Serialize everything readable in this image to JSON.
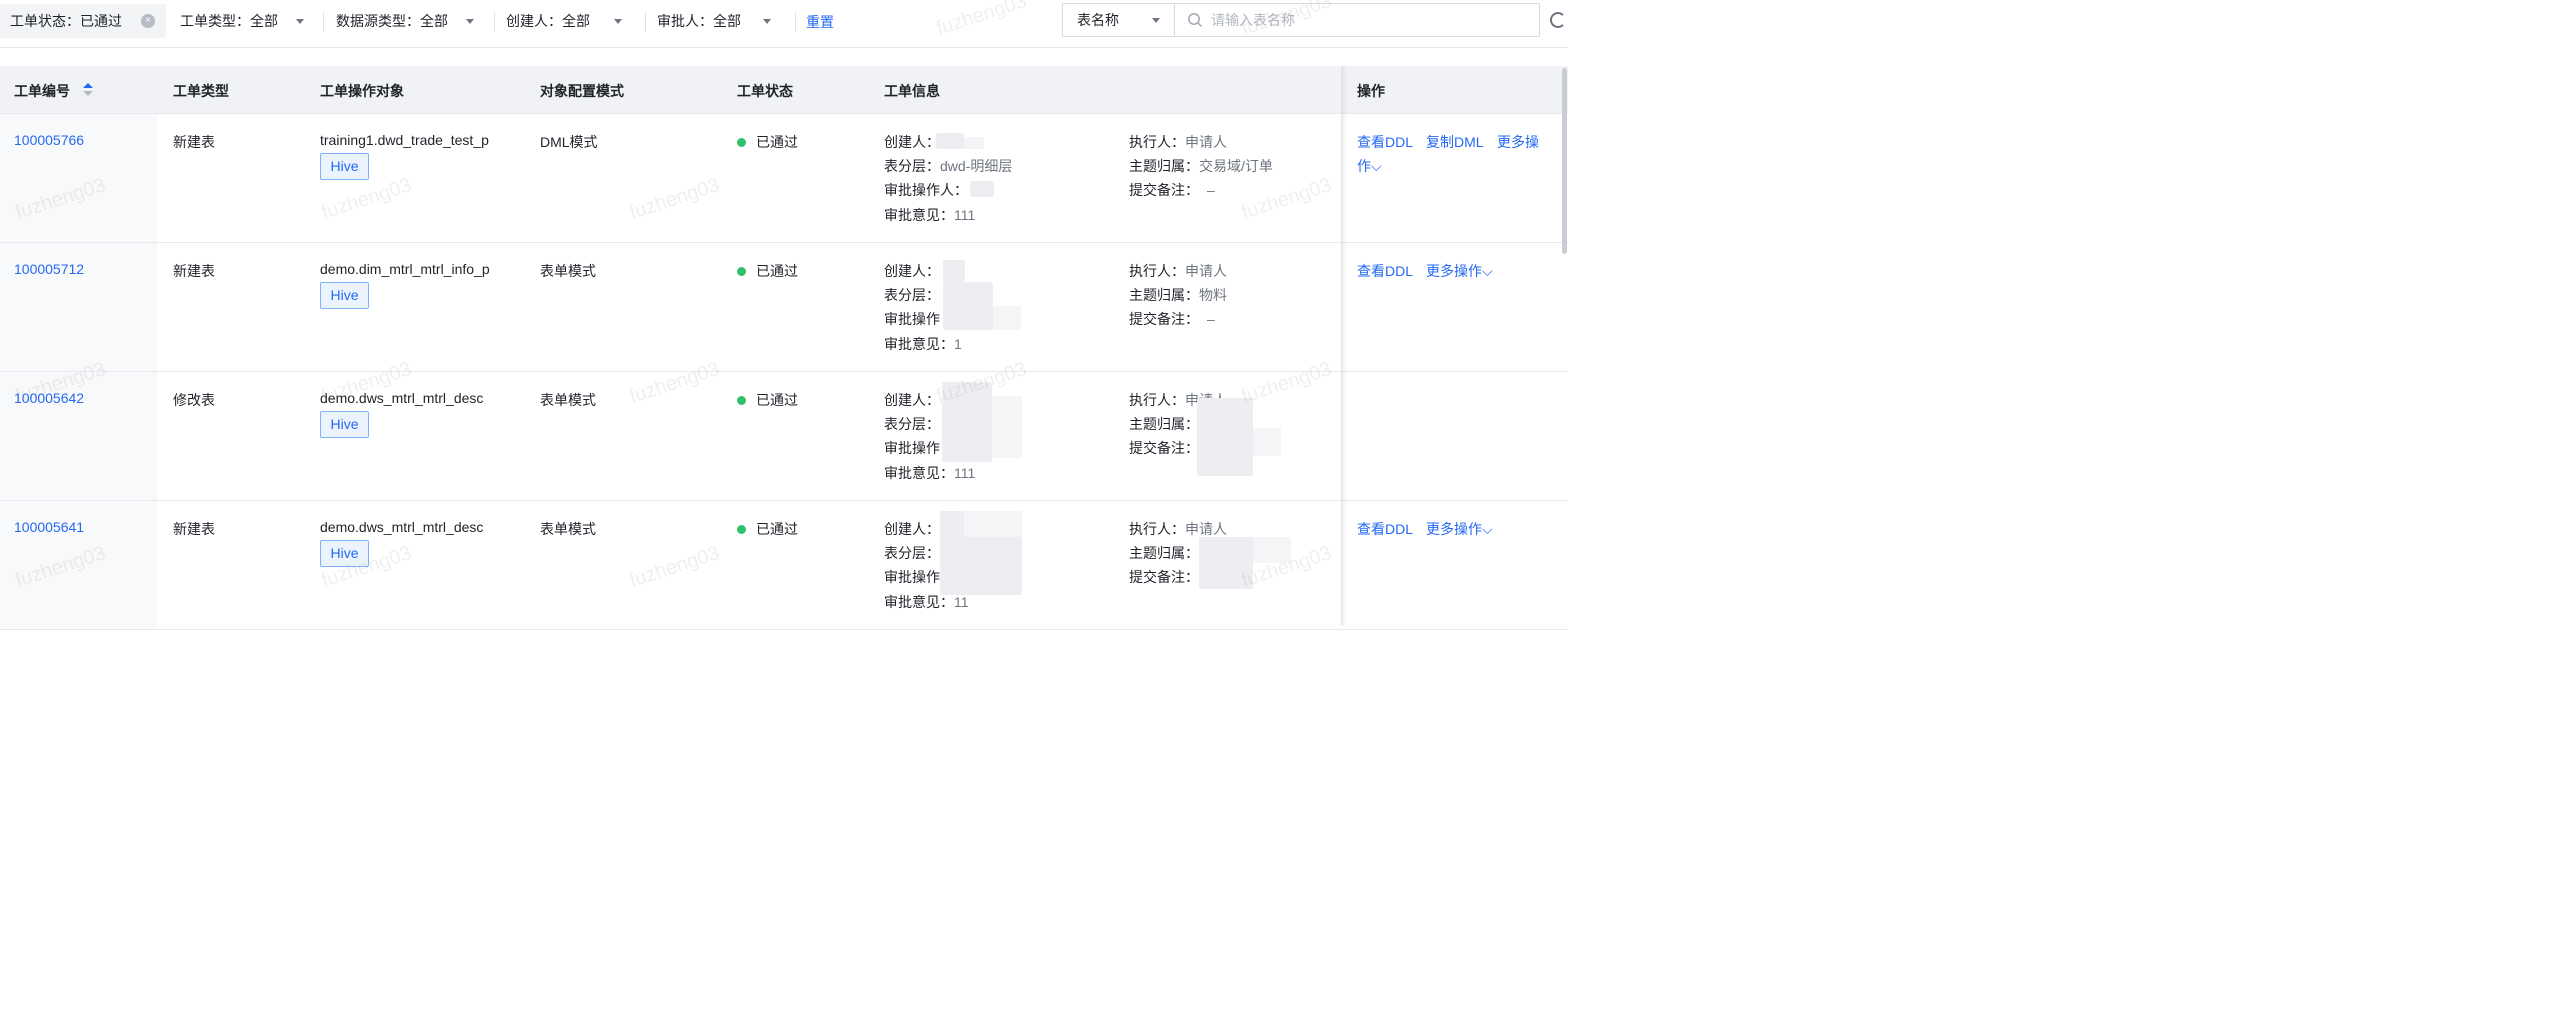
{
  "filters": {
    "status": {
      "label": "工单状态：",
      "value": "已通过"
    },
    "type": {
      "label": "工单类型：",
      "value": "全部"
    },
    "datasource": {
      "label": "数据源类型：",
      "value": "全部"
    },
    "creator": {
      "label": "创建人：",
      "value": "全部"
    },
    "approver": {
      "label": "审批人：",
      "value": "全部"
    },
    "reset": "重置"
  },
  "search": {
    "field_option": "表名称",
    "placeholder": "请输入表名称"
  },
  "table": {
    "headers": {
      "id": "工单编号",
      "type": "工单类型",
      "target": "工单操作对象",
      "mode": "对象配置模式",
      "status": "工单状态",
      "info": "工单信息",
      "ops": "操作"
    },
    "info_keys": {
      "creator": "创建人：",
      "layer": "表分层：",
      "approver": "审批操作人：",
      "approver_short": "审批操作",
      "opinion": "审批意见：",
      "executor": "执行人：",
      "domain": "主题归属：",
      "remark": "提交备注："
    },
    "rows": [
      {
        "id": "100005766",
        "type": "新建表",
        "target": "training1.dwd_trade_test_p",
        "tag": "Hive",
        "mode": "DML模式",
        "status": "已通过",
        "layer": "dwd-明细层",
        "opinion": "111",
        "executor": "申请人",
        "domain": "交易域/订单",
        "remark": "–",
        "op1": "查看DDL",
        "op2": "复制DML",
        "op3a": "更多操",
        "op3b": "作"
      },
      {
        "id": "100005712",
        "type": "新建表",
        "target": "demo.dim_mtrl_mtrl_info_p",
        "tag": "Hive",
        "mode": "表单模式",
        "status": "已通过",
        "opinion": "1",
        "executor": "申请人",
        "domain": "物料",
        "remark": "–",
        "op1": "查看DDL",
        "op2": "更多操作"
      },
      {
        "id": "100005642",
        "type": "修改表",
        "target": "demo.dws_mtrl_mtrl_desc",
        "tag": "Hive",
        "mode": "表单模式",
        "status": "已通过",
        "opinion": "111",
        "executor": "申请人"
      },
      {
        "id": "100005641",
        "type": "新建表",
        "target": "demo.dws_mtrl_mtrl_desc",
        "tag": "Hive",
        "mode": "表单模式",
        "status": "已通过",
        "opinion": "11",
        "executor": "申请人",
        "op1": "查看DDL",
        "op2": "更多操作"
      }
    ]
  },
  "watermark": "fuzheng03",
  "colors": {
    "link": "#2468f2",
    "status_ok": "#30bf6c",
    "header_bg": "#f1f2f5",
    "tag_bg": "#eaf3fe"
  }
}
